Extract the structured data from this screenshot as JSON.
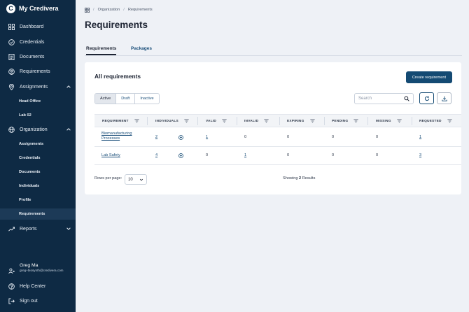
{
  "app": {
    "name": "My Credivera"
  },
  "sidebar": {
    "items": [
      {
        "label": "Dashboard",
        "icon": "grid-icon"
      },
      {
        "label": "Credentials",
        "icon": "check-circle-icon"
      },
      {
        "label": "Documents",
        "icon": "document-icon"
      },
      {
        "label": "Requirements",
        "icon": "requirements-icon"
      },
      {
        "label": "Assignments",
        "icon": "location-pin-icon"
      },
      {
        "label": "Organization",
        "icon": "globe-icon"
      },
      {
        "label": "Reports",
        "icon": "trend-icon"
      }
    ],
    "assignments_sub": [
      "Head Office",
      "Lab 02"
    ],
    "organization_sub": [
      "Assignments",
      "Credentials",
      "Documents",
      "Individuals",
      "Profile",
      "Requirements"
    ],
    "user": {
      "name": "Greg Ma",
      "email": "greg+biosynth@credivera.com"
    },
    "help": "Help Center",
    "signout": "Sign out"
  },
  "breadcrumb": {
    "home_icon": "apps-grid-icon",
    "items": [
      "Organization",
      "Requirements"
    ],
    "separator": "/"
  },
  "page": {
    "title": "Requirements"
  },
  "tabs": [
    "Requirements",
    "Packages"
  ],
  "card": {
    "title": "All requirements",
    "create_label": "Create requirement",
    "filters": [
      "Active",
      "Draft",
      "Inactive"
    ],
    "search_placeholder": "Search"
  },
  "table": {
    "columns": [
      "REQUIREMENT",
      "INDIVIDUALS",
      "VALID",
      "INVALID",
      "EXPIRING",
      "PENDING",
      "MISSING",
      "REQUESTED"
    ],
    "rows": [
      {
        "requirement": "Biomanufacturing Processes",
        "individuals": "2",
        "valid": "1",
        "invalid": "0",
        "expiring": "0",
        "pending": "0",
        "missing": "0",
        "requested": "1"
      },
      {
        "requirement": "Lab Safety",
        "individuals": "4",
        "valid": "0",
        "invalid": "1",
        "expiring": "0",
        "pending": "0",
        "missing": "0",
        "requested": "3"
      }
    ]
  },
  "footer": {
    "rows_per_page_label": "Rows per page:",
    "rows_per_page_value": "10",
    "showing_prefix": "Showing",
    "showing_count": "2",
    "showing_suffix": "Results"
  },
  "colors": {
    "sidebar": "#0e2a44",
    "primary": "#144a73",
    "link": "#1b4f7a"
  }
}
